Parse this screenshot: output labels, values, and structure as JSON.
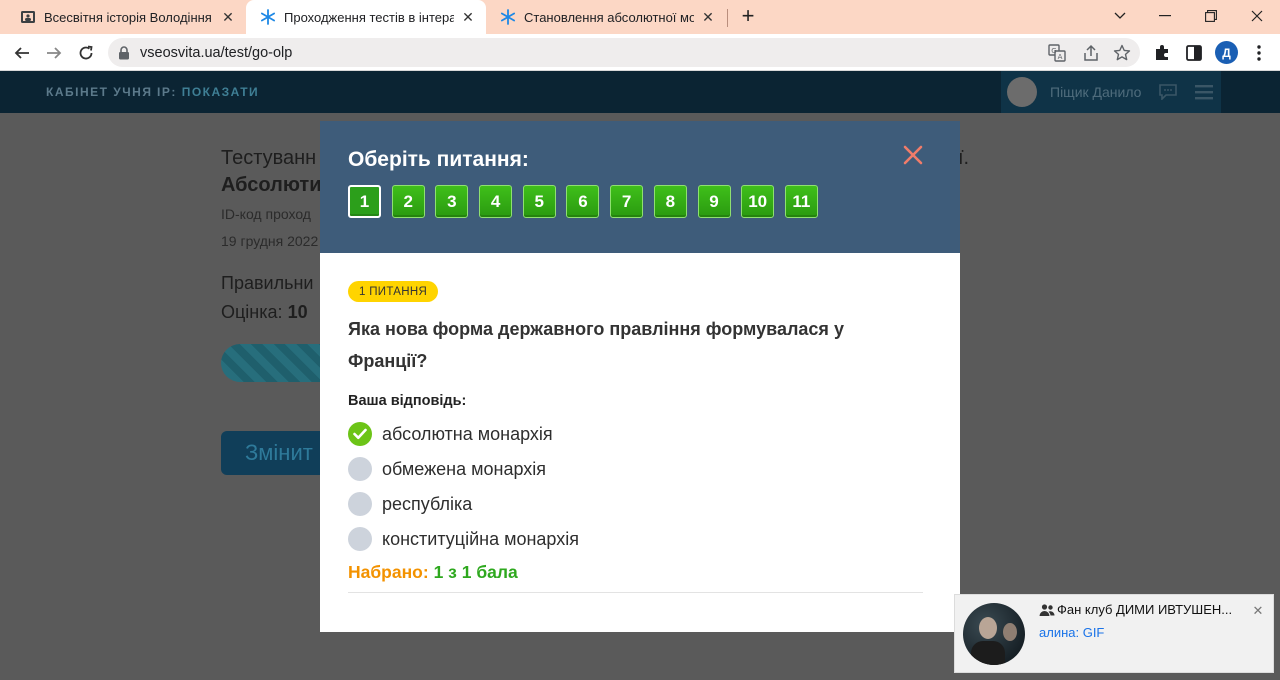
{
  "browser": {
    "tabs": [
      {
        "title": "Всесвітня історія Володіння Габ",
        "active": false,
        "favicon": "classroom-icon"
      },
      {
        "title": "Проходження тестів в інтеракти",
        "active": true,
        "favicon": "vseosvita-snowflake-icon"
      },
      {
        "title": "Становлення абсолютної монар",
        "active": false,
        "favicon": "vseosvita-snowflake-icon"
      }
    ],
    "url": "vseosvita.ua/test/go-olp",
    "profile_initial": "Д"
  },
  "site": {
    "brand": "КАБІНЕТ УЧНЯ",
    "ip_label": "IP:",
    "ip_link": "ПОКАЗАТИ",
    "user_name": "Піщик Данило"
  },
  "background_page": {
    "title_start": "Тестуванн",
    "title_end": "ї.",
    "title_line2": "Абсолюти",
    "id_label": "ID-код проход",
    "date": "19 грудня 2022",
    "correct_label": "Правильни",
    "grade_label": "Оцінка:",
    "grade_value": "10",
    "change_button": "Змінит"
  },
  "modal": {
    "title": "Оберіть питання:",
    "question_numbers": [
      "1",
      "2",
      "3",
      "4",
      "5",
      "6",
      "7",
      "8",
      "9",
      "10",
      "11"
    ],
    "current_question": "1",
    "badge": "1 ПИТАННЯ",
    "question": "Яка нова форма державного правління формувалася у Франції?",
    "your_answer_label": "Ваша відповідь:",
    "options": [
      {
        "text": "абсолютна монархія",
        "selected": true
      },
      {
        "text": "обмежена монархія",
        "selected": false
      },
      {
        "text": "республіка",
        "selected": false
      },
      {
        "text": "конституційна монархія",
        "selected": false
      }
    ],
    "score_label": "Набрано:",
    "score_value": "1 з 1 бала"
  },
  "notification": {
    "title": "Фан клуб ДИМИ ИВТУШЕН...",
    "message": "алина: GIF"
  },
  "colors": {
    "tabbar": "#fcd7c5",
    "modal_header": "#3e5c7a",
    "question_button": "#2ea81e",
    "badge": "#ffd400",
    "score_label": "#f39200",
    "score_value": "#2ea81e",
    "close_x": "#f07c6a"
  }
}
